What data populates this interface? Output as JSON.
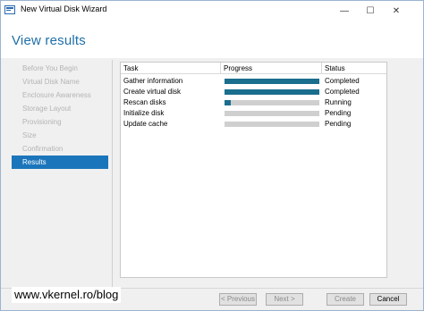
{
  "window": {
    "title": "New Virtual Disk Wizard",
    "controls": {
      "minimize": "—",
      "maximize": "☐",
      "close": "✕"
    }
  },
  "header": {
    "title": "View results"
  },
  "nav": {
    "items": [
      {
        "label": "Before You Begin"
      },
      {
        "label": "Virtual Disk Name"
      },
      {
        "label": "Enclosure Awareness"
      },
      {
        "label": "Storage Layout"
      },
      {
        "label": "Provisioning"
      },
      {
        "label": "Size"
      },
      {
        "label": "Confirmation"
      },
      {
        "label": "Results"
      }
    ],
    "active": "Results"
  },
  "results": {
    "columns": {
      "task": "Task",
      "progress": "Progress",
      "status": "Status"
    },
    "rows": [
      {
        "task": "Gather information",
        "progress": 1.0,
        "status": "Completed"
      },
      {
        "task": "Create virtual disk",
        "progress": 1.0,
        "status": "Completed"
      },
      {
        "task": "Rescan disks",
        "progress": 0.07,
        "status": "Running"
      },
      {
        "task": "Initialize disk",
        "progress": 0,
        "status": "Pending"
      },
      {
        "task": "Update cache",
        "progress": 0,
        "status": "Pending"
      }
    ]
  },
  "buttons": {
    "previous": "< Previous",
    "next": "Next >",
    "create": "Create",
    "cancel": "Cancel"
  },
  "watermark": "www.vkernel.ro/blog",
  "colors": {
    "accent": "#1b75bb",
    "progress_fill": "#1a6e8e",
    "header_title": "#1e6fa8"
  }
}
